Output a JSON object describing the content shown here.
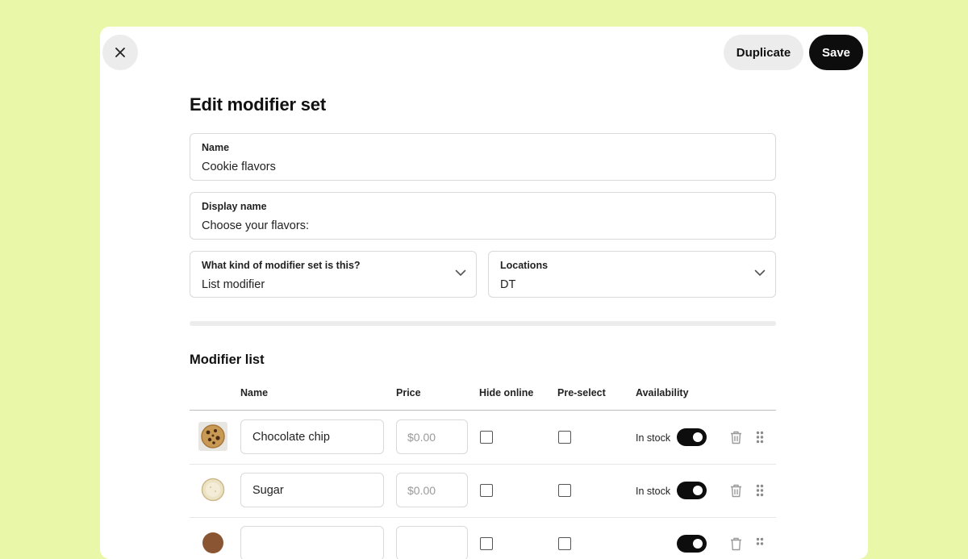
{
  "header": {
    "close_icon": "close-icon",
    "duplicate_label": "Duplicate",
    "save_label": "Save"
  },
  "page": {
    "title": "Edit modifier set"
  },
  "form": {
    "name": {
      "label": "Name",
      "value": "Cookie flavors"
    },
    "display_name": {
      "label": "Display name",
      "value": "Choose your flavors:"
    },
    "set_type": {
      "label": "What kind of modifier set is this?",
      "value": "List modifier",
      "icon": "chevron-down-icon"
    },
    "locations": {
      "label": "Locations",
      "value": "DT",
      "icon": "chevron-down-icon"
    }
  },
  "modifier_list": {
    "title": "Modifier list",
    "columns": [
      "Name",
      "Price",
      "Hide online",
      "Pre-select",
      "Availability"
    ],
    "rows": [
      {
        "name": "Chocolate chip",
        "price_placeholder": "$0.00",
        "hide_online": false,
        "pre_select": false,
        "availability": "In stock",
        "in_stock": true,
        "thumb": "chocolate-chip-cookie"
      },
      {
        "name": "Sugar",
        "price_placeholder": "$0.00",
        "hide_online": false,
        "pre_select": false,
        "availability": "In stock",
        "in_stock": true,
        "thumb": "sugar-cookie"
      }
    ]
  },
  "colors": {
    "background": "#e9f8a8",
    "panel": "#ffffff",
    "primary_button": "#0d0d0d",
    "secondary_button": "#ececec",
    "border": "#d9d9d9"
  }
}
